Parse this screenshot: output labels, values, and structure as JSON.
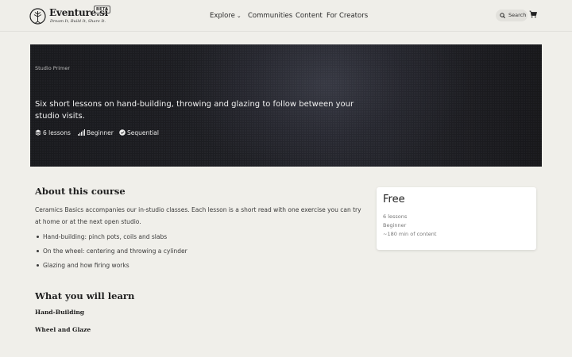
{
  "header": {
    "brand": "Eventure.si",
    "beta_badge": "BETA",
    "tagline": "Dream It, Build It, Share It.",
    "nav": {
      "explore": "Explore",
      "communities": "Communities",
      "content": "Content",
      "for_creators": "For Creators"
    },
    "search_label": "Search"
  },
  "hero": {
    "kicker": "Studio Primer",
    "title": "Six short lessons on hand-building, throwing and glazing to follow between your studio visits.",
    "meta": {
      "lessons": "6 lessons",
      "level": "Beginner",
      "order": "Sequential"
    }
  },
  "about": {
    "heading": "About this course",
    "description": "Ceramics Basics accompanies our in-studio classes. Each lesson is a short read with one exercise you can try at home or at the next open studio.",
    "bullets": [
      "Hand-building: pinch pots, coils and slabs",
      "On the wheel: centering and throwing a cylinder",
      "Glazing and how firing works"
    ]
  },
  "learn": {
    "heading": "What you will learn",
    "sections": [
      "Hand-Building",
      "Wheel and Glaze"
    ]
  },
  "card": {
    "price": "Free",
    "lines": [
      "6 lessons",
      "Beginner",
      "~180 min of content"
    ]
  },
  "colors": {
    "page_bg": "#f0efea",
    "hero_bg": "#212228",
    "text": "#2a2a2a",
    "muted": "#777777"
  },
  "icons": {
    "logo": "tree-logo-icon",
    "explore_chevron": "chevron-down-icon",
    "search": "search-icon",
    "cart": "cart-icon",
    "lessons": "layers-icon",
    "level": "signal-bars-icon",
    "order": "check-circle-icon"
  }
}
